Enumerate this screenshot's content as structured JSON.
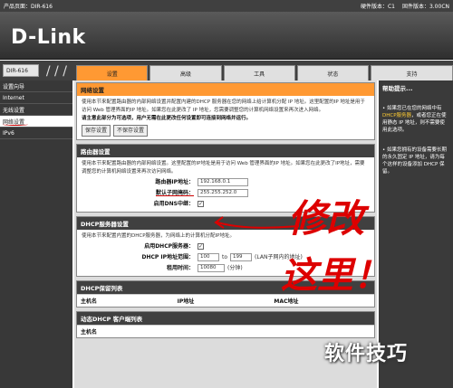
{
  "topbar": {
    "product": "产品页面：DIR-616",
    "hardware": "硬件版本：C1",
    "firmware": "固件版本：3.00CN"
  },
  "brand": {
    "logo_text": "D-Link",
    "accent_color": "#ff9933"
  },
  "model": "DIR-616",
  "tabs": [
    {
      "label": "设置",
      "active": true
    },
    {
      "label": "高级",
      "active": false
    },
    {
      "label": "工具",
      "active": false
    },
    {
      "label": "状态",
      "active": false
    },
    {
      "label": "支持",
      "active": false
    }
  ],
  "sidebar": {
    "items": [
      {
        "label": "设置向导"
      },
      {
        "label": "Internet"
      },
      {
        "label": "无线设置"
      },
      {
        "label": "网络设置"
      },
      {
        "label": "IPv6"
      }
    ]
  },
  "net_panel": {
    "title": "网络设置",
    "desc": "使用本节来配置路由器的内部网络设置并配置内建的DHCP 服务器在您的网络上给计算机分配 IP 地址。这里配置的IP 地址是用于访问 Web 管理界面的IP 地址。如果您在此更改了 IP 地址，您需要调整您的计算机网络设置来再次进入网络。",
    "warning": "请主意此部分为可选项，用户无需在此更改任何设置即可连接到网络并运行。",
    "save_label": "保存设置",
    "nosave_label": "不保存设置"
  },
  "router_panel": {
    "title": "路由器设置",
    "desc": "使用本节来配置路由器的内部网络设置。这里配置的IP地址是用于访问 Web 管理界面的IP 地址。如果您在此更改了IP地址，需要调整您的计算机网络设置来再次访问网络。",
    "ip_label": "路由器IP地址：",
    "ip_value": "192.168.0.1",
    "mask_label": "默认子网掩码：",
    "mask_value": "255.255.252.0",
    "dns_label": "启用DNS中继："
  },
  "dhcp_panel": {
    "title": "DHCP服务器设置",
    "desc": "使用本节来配置内置的DHCP服务器，为网络上的计算机分配IP地址。",
    "enable_label": "启用DHCP服务器：",
    "range_label": "DHCP IP地址范围：",
    "range_start": "100",
    "range_to": "to",
    "range_end": "199",
    "range_note": "(LAN子网内的地址)",
    "lease_label": "租用时间：",
    "lease_value": "10080",
    "lease_unit": "(分钟)"
  },
  "reserve_panel": {
    "title": "DHCP保留列表",
    "col_host": "主机名",
    "col_ip": "IP地址",
    "col_mac": "MAC地址"
  },
  "dyn_panel": {
    "title": "动态DHCP 客户端列表",
    "col_host": "主机名"
  },
  "help": {
    "title": "帮助提示...",
    "tip1_a": "如果您已在您的网络中有 ",
    "tip1_b": "DHCP服务器",
    "tip1_c": "，或者您正在使用静态 IP 地址，则不需要使用此选项。",
    "tip2": "如果您拥有的设备需要长期的永久固定 IP 地址，请为每个这样的设备添加 DHCP 保留。"
  },
  "annotations": {
    "line1": "修改",
    "line2": "这里！"
  },
  "watermark": "软件技巧"
}
